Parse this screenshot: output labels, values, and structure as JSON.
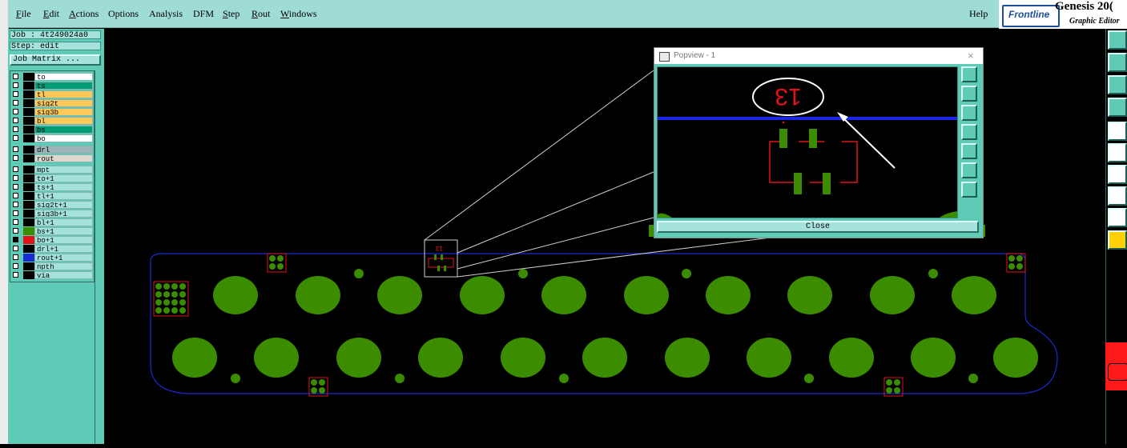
{
  "menubar": {
    "items": [
      {
        "label": "File",
        "u": "F",
        "rest": "ile"
      },
      {
        "label": "Edit",
        "u": "E",
        "rest": "dit"
      },
      {
        "label": "Actions",
        "u": "A",
        "rest": "ctions"
      },
      {
        "label": "Options",
        "u": "",
        "rest": "Options"
      },
      {
        "label": "Analysis",
        "u": "",
        "rest": "Analysis"
      },
      {
        "label": "DFM",
        "u": "",
        "rest": "DFM"
      },
      {
        "label": "Step",
        "u": "S",
        "rest": "tep"
      },
      {
        "label": "Rout",
        "u": "R",
        "rest": "out"
      },
      {
        "label": "Windows",
        "u": "W",
        "rest": "indows"
      }
    ],
    "help": "Help"
  },
  "logo": {
    "brand": "Frontline",
    "app_name": "Genesis 20(",
    "subtitle": "Graphic Editor"
  },
  "job_panel": {
    "job": "Job : 4t249024a0",
    "step": "Step: edit",
    "job_matrix_button": "Job Matrix ..."
  },
  "layers": [
    {
      "name": "to",
      "color": "#ffffff"
    },
    {
      "name": "ts",
      "color": "#009b77"
    },
    {
      "name": "tl",
      "color": "#ffc859"
    },
    {
      "name": "sig2t",
      "color": "#ffc859"
    },
    {
      "name": "sig3b",
      "color": "#ffc859"
    },
    {
      "name": "bl",
      "color": "#ffc859"
    },
    {
      "name": "bs",
      "color": "#009b77"
    },
    {
      "name": "bo",
      "color": "#ffffff"
    },
    {
      "name": "drl",
      "color": "#9db3b8"
    },
    {
      "name": "rout",
      "color": "#dcd8d0"
    },
    {
      "name": "mpt",
      "color": "#a6e2dc"
    },
    {
      "name": "to+1",
      "color": "#a6e2dc"
    },
    {
      "name": "ts+1",
      "color": "#a6e2dc"
    },
    {
      "name": "tl+1",
      "color": "#a6e2dc"
    },
    {
      "name": "sig2t+1",
      "color": "#a6e2dc"
    },
    {
      "name": "sig3b+1",
      "color": "#a6e2dc"
    },
    {
      "name": "bl+1",
      "color": "#a6e2dc"
    },
    {
      "name": "bs+1",
      "color": "#a6e2dc"
    },
    {
      "name": "bo+1",
      "color": "#a6e2dc"
    },
    {
      "name": "drl+1",
      "color": "#a6e2dc"
    },
    {
      "name": "rout+1",
      "color": "#a6e2dc"
    },
    {
      "name": "npth",
      "color": "#a6e2dc"
    },
    {
      "name": "via",
      "color": "#a6e2dc"
    }
  ],
  "popview": {
    "title": "Popview - 1",
    "close_x": "×",
    "close_button": "Close",
    "annotation_text": "13"
  },
  "canvas": {
    "mark_label": "13"
  },
  "colors": {
    "board_outline": "#1a2bd0",
    "pad_green": "#3c8c00",
    "mark_red": "#e0131a",
    "panel_teal": "#5fcbb6"
  }
}
